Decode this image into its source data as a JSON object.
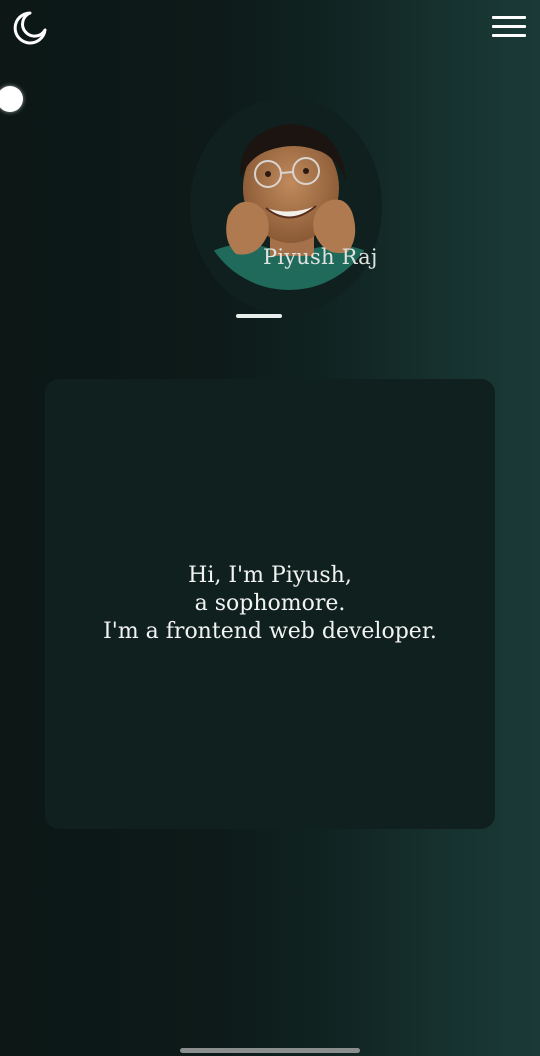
{
  "header": {
    "theme_toggle_icon": "moon-icon",
    "menu_icon": "hamburger-menu-icon"
  },
  "profile": {
    "name": "Piyush Raj",
    "avatar_icon": "profile-photo",
    "ring_color": "#10201f"
  },
  "intro": {
    "lines": [
      "Hi, I'm Piyush,",
      "a sophomore.",
      "I'm a frontend web developer."
    ]
  },
  "colors": {
    "background_dark": "#0c1716",
    "background_teal": "#1b3a37",
    "card": "#10201f",
    "text": "#f2f4f2"
  }
}
